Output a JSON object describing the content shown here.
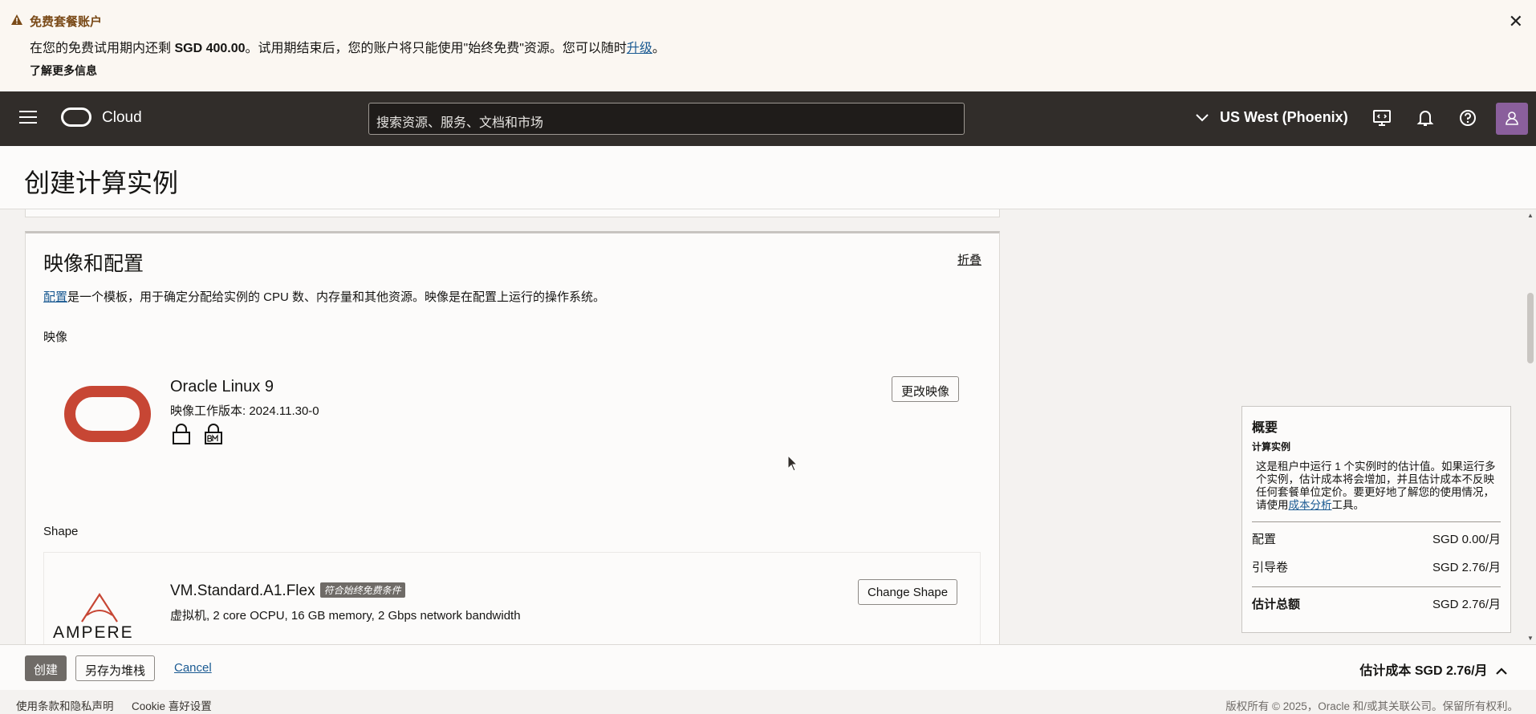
{
  "banner": {
    "title": "免费套餐账户",
    "message_pre": "在您的免费试用期内还剩 ",
    "amount": "SGD 400.00",
    "message_post": "。试用期结束后，您的账户将只能使用\"始终免费\"资源。您可以随时",
    "upgrade_link": "升级",
    "period": "。",
    "learn_more": "了解更多信息"
  },
  "topbar": {
    "logo_text": "Cloud",
    "search_placeholder": "搜索资源、服务、文档和市场",
    "region": "US West (Phoenix)"
  },
  "page": {
    "title": "创建计算实例"
  },
  "section": {
    "title": "映像和配置",
    "collapse": "折叠",
    "desc_link": "配置",
    "desc_text": "是一个模板，用于确定分配给实例的 CPU 数、内存量和其他资源。映像是在配置上运行的操作系统。",
    "image_label": "映像",
    "image_name": "Oracle Linux 9",
    "image_version": "映像工作版本: 2024.11.30-0",
    "change_image": "更改映像",
    "shape_label": "Shape",
    "shape_vendor": "AMPERE",
    "shape_name": "VM.Standard.A1.Flex",
    "shape_badge": "符合始终免费条件",
    "shape_desc": "虚拟机, 2 core OCPU, 16 GB memory, 2 Gbps network bandwidth",
    "change_shape": "Change Shape"
  },
  "summary": {
    "title": "概要",
    "subtitle": "计算实例",
    "note_pre": "这是租户中运行 1 个实例时的估计值。如果运行多个实例，估计成本将会增加，并且估计成本不反映任何套餐单位定价。要更好地了解您的使用情况，请使用",
    "note_link": "成本分析",
    "note_post": "工具。",
    "rows": [
      {
        "label": "配置",
        "value": "SGD 0.00/月"
      },
      {
        "label": "引导卷",
        "value": "SGD 2.76/月"
      }
    ],
    "total_label": "估计总额",
    "total_value": "SGD 2.76/月"
  },
  "bottom": {
    "create": "创建",
    "save_stack": "另存为堆栈",
    "cancel": "Cancel",
    "estimate": "估计成本 SGD 2.76/月"
  },
  "footer": {
    "terms": "使用条款和隐私声明",
    "cookie": "Cookie 喜好设置",
    "copyright": "版权所有 © 2025，Oracle 和/或其关联公司。保留所有权利。"
  }
}
